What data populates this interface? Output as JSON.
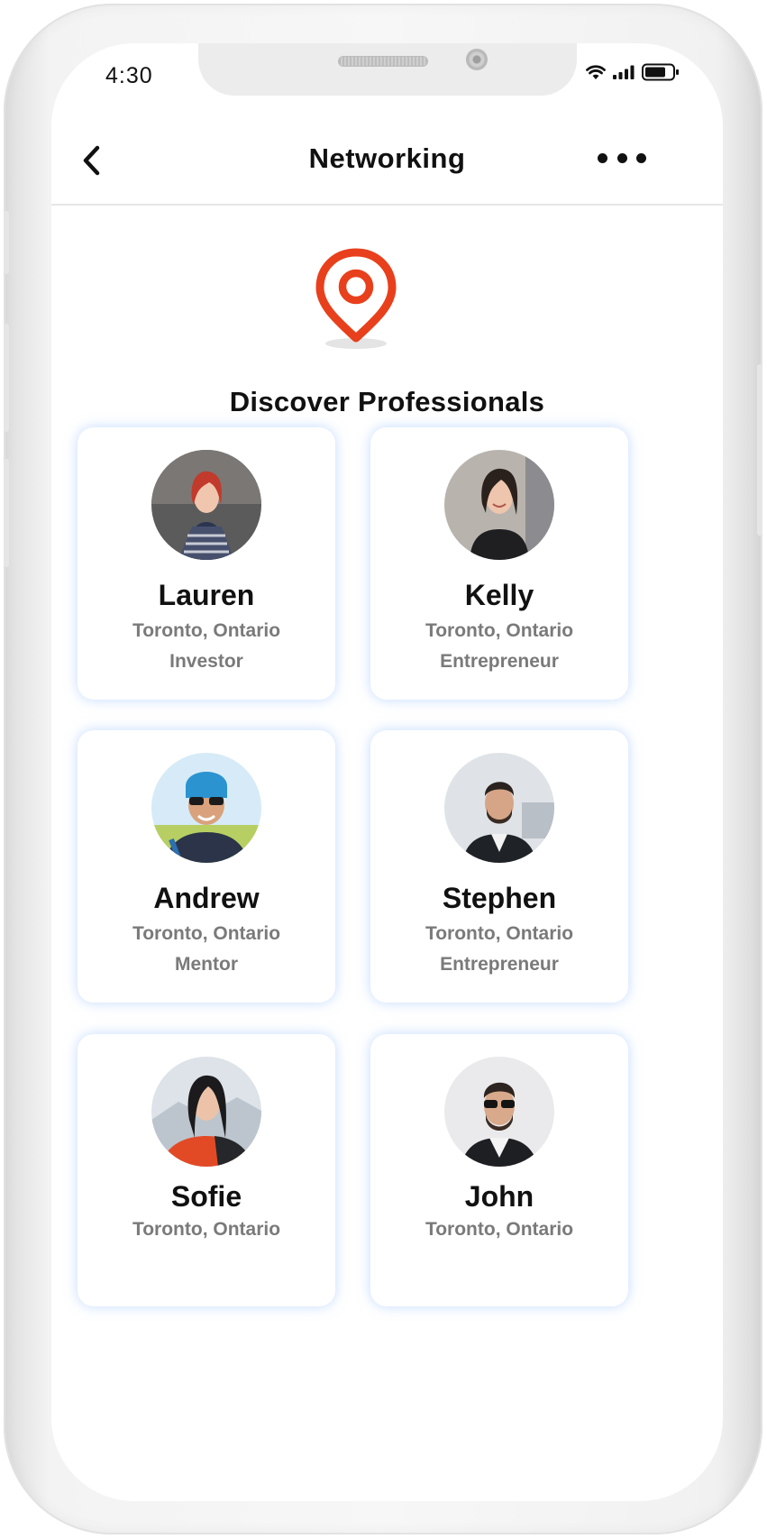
{
  "status_bar": {
    "time": "4:30",
    "icons": [
      "wifi-icon",
      "signal-icon",
      "battery-icon"
    ]
  },
  "navbar": {
    "title": "Networking",
    "back_icon": "chevron-left-icon",
    "more_icon": "more-horizontal-icon"
  },
  "hero": {
    "icon": "location-pin-icon",
    "title": "Discover Professionals"
  },
  "colors": {
    "accent": "#E8401C",
    "card_glow": "#96BEFF",
    "secondary_text": "#7A7A7A"
  },
  "professionals": [
    {
      "name": "Lauren",
      "location": "Toronto, Ontario",
      "role": "Investor"
    },
    {
      "name": "Kelly",
      "location": "Toronto, Ontario",
      "role": "Entrepreneur"
    },
    {
      "name": "Andrew",
      "location": "Toronto, Ontario",
      "role": "Mentor"
    },
    {
      "name": "Stephen",
      "location": "Toronto, Ontario",
      "role": "Entrepreneur"
    },
    {
      "name": "Sofie",
      "location": "Toronto, Ontario"
    },
    {
      "name": "John",
      "location": "Toronto, Ontario"
    }
  ]
}
